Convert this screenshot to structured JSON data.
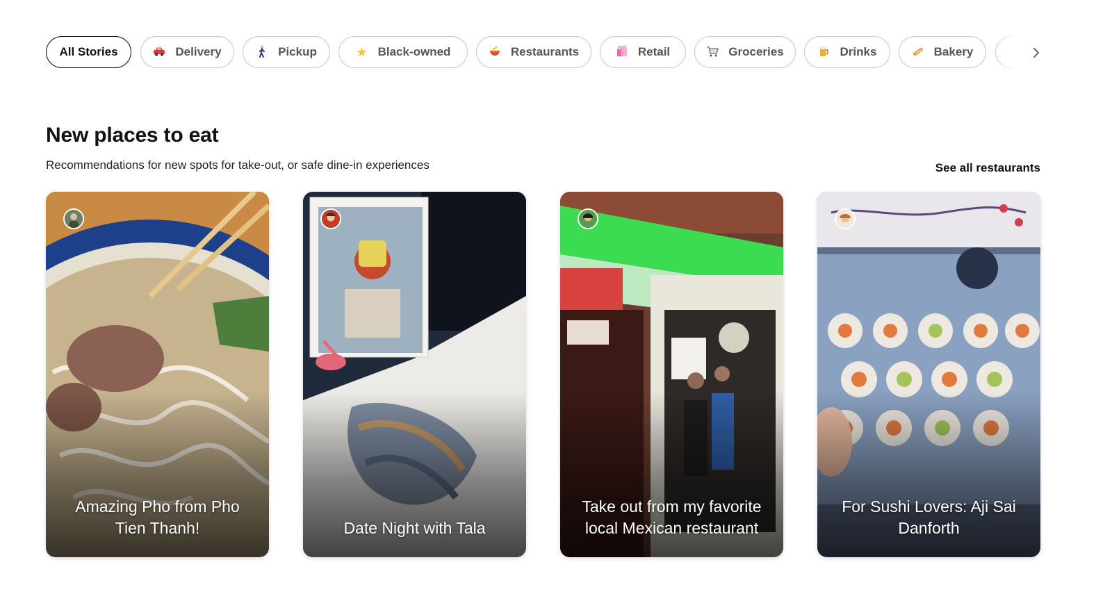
{
  "filters": [
    {
      "label": "All Stories",
      "icon": "",
      "active": true
    },
    {
      "label": "Delivery",
      "icon": "car-icon"
    },
    {
      "label": "Pickup",
      "icon": "walking-person-icon"
    },
    {
      "label": "Black-owned",
      "icon": "star-icon"
    },
    {
      "label": "Restaurants",
      "icon": "bowl-icon"
    },
    {
      "label": "Retail",
      "icon": "shopping-bags-icon"
    },
    {
      "label": "Groceries",
      "icon": "shopping-cart-icon"
    },
    {
      "label": "Drinks",
      "icon": "beer-icon"
    },
    {
      "label": "Bakery",
      "icon": "baguette-icon"
    }
  ],
  "section": {
    "title": "New places to eat",
    "subtitle": "Recommendations for new spots for take-out, or safe dine-in experiences",
    "see_all": "See all restaurants"
  },
  "stories": [
    {
      "caption": "Amazing Pho from Pho Tien Thanh!"
    },
    {
      "caption": "Date Night with Tala"
    },
    {
      "caption": "Take out from my favorite local Mexican restaurant"
    },
    {
      "caption": "For Sushi Lovers: Aji Sai Danforth"
    }
  ],
  "colors": {
    "chip_border": "#c9c9c9",
    "chip_active_border": "#111111",
    "chip_text": "#555555",
    "text": "#111111"
  }
}
